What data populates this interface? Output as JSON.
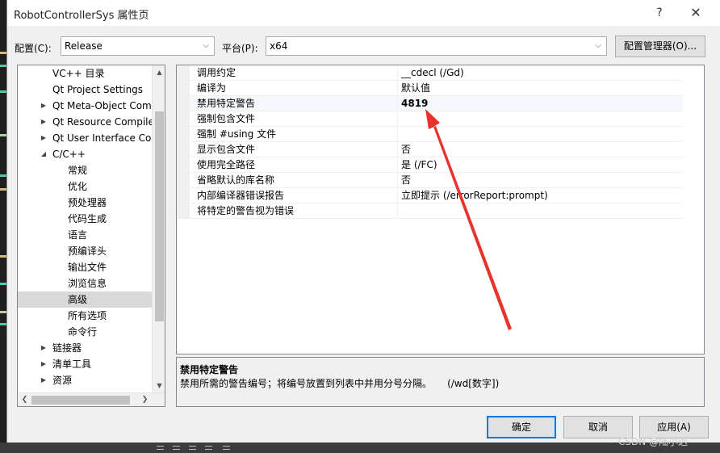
{
  "window": {
    "title": "RobotControllerSys 属性页",
    "help_label": "?",
    "close_label": "✕"
  },
  "toolbar": {
    "config_label": "配置(C):",
    "config_value": "Release",
    "platform_label": "平台(P):",
    "platform_value": "x64",
    "config_manager_label": "配置管理器(O)..."
  },
  "tree": {
    "items": [
      {
        "label": "VC++ 目录"
      },
      {
        "label": "Qt Project Settings"
      },
      {
        "label": "Qt Meta-Object Com"
      },
      {
        "label": "Qt Resource Compile"
      },
      {
        "label": "Qt User Interface Co"
      },
      {
        "label": "C/C++"
      },
      {
        "label": "常规"
      },
      {
        "label": "优化"
      },
      {
        "label": "预处理器"
      },
      {
        "label": "代码生成"
      },
      {
        "label": "语言"
      },
      {
        "label": "预编译头"
      },
      {
        "label": "输出文件"
      },
      {
        "label": "浏览信息"
      },
      {
        "label": "高级"
      },
      {
        "label": "所有选项"
      },
      {
        "label": "命令行"
      },
      {
        "label": "链接器"
      },
      {
        "label": "清单工具"
      },
      {
        "label": "资源"
      }
    ]
  },
  "grid": {
    "rows": [
      {
        "name": "调用约定",
        "value": "__cdecl (/Gd)"
      },
      {
        "name": "编译为",
        "value": "默认值"
      },
      {
        "name": "禁用特定警告",
        "value": "4819"
      },
      {
        "name": "强制包含文件",
        "value": ""
      },
      {
        "name": "强制 #using 文件",
        "value": ""
      },
      {
        "name": "显示包含文件",
        "value": "否"
      },
      {
        "name": "使用完全路径",
        "value": "是 (/FC)"
      },
      {
        "name": "省略默认的库名称",
        "value": "否"
      },
      {
        "name": "内部编译器错误报告",
        "value": "立即提示 (/errorReport:prompt)"
      },
      {
        "name": "将特定的警告视为错误",
        "value": ""
      }
    ]
  },
  "description": {
    "title": "禁用特定警告",
    "text": "禁用所需的警告编号；将编号放置到列表中并用分号分隔。     (/wd[数字])"
  },
  "buttons": {
    "ok": "确定",
    "cancel": "取消",
    "apply": "应用(A)"
  },
  "watermark": "CSDN @陆小迟",
  "colors": {
    "annotation_arrow": "#e8322b",
    "focus_border": "#0078d7",
    "selected_tree_bg": "#d9d9d9"
  }
}
